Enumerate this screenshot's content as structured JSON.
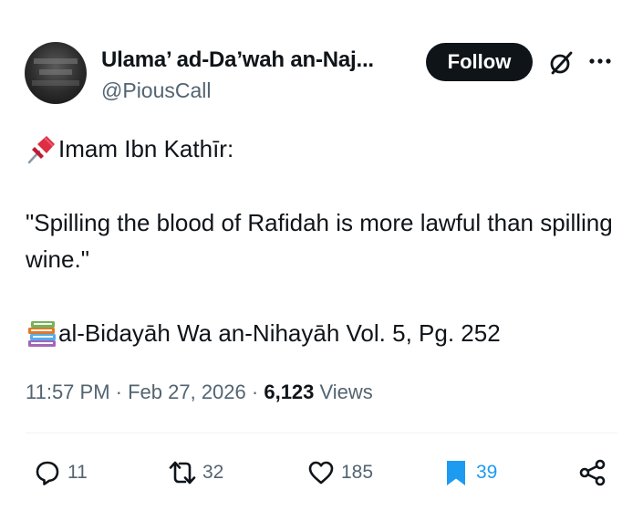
{
  "author": {
    "display_name": "Ulama’ ad-Da’wah an-Naj...",
    "handle": "@PiousCall",
    "avatar_icon": "profile-photo"
  },
  "header": {
    "follow_label": "Follow",
    "grok_icon": "grok-icon",
    "more_icon": "more-horizontal-icon"
  },
  "tweet": {
    "line1": "Imam Ibn Kathīr:",
    "quote": "\"Spilling the blood of Rafidah is more lawful than spilling wine.\"",
    "source": "al-Bidayāh Wa an-Nihayāh Vol. 5, Pg. 252",
    "emoji1": "pushpin-emoji",
    "emoji2": "books-emoji"
  },
  "meta": {
    "time": "11:57 PM",
    "sep1": " · ",
    "date": "Feb 27, 2026",
    "sep2": " · ",
    "views_count": "6,123",
    "views_label": " Views"
  },
  "actions": {
    "replies": "11",
    "reposts": "32",
    "likes": "185",
    "bookmarks": "39"
  },
  "colors": {
    "text": "#0f1419",
    "muted": "#536471",
    "bookmark_blue": "#1d9bf0",
    "button_bg": "#0f1419"
  }
}
